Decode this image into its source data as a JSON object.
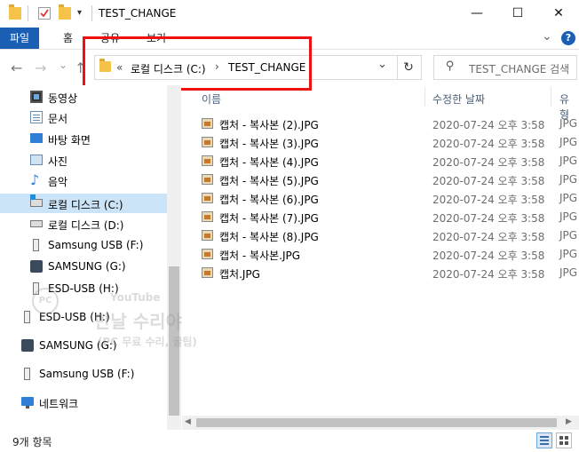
{
  "window": {
    "title": "TEST_CHANGE",
    "minimize": "—",
    "maximize": "☐",
    "close": "✕"
  },
  "ribbon": {
    "file_tab": "파일",
    "tabs": [
      "홈",
      "공유",
      "보기"
    ],
    "expand": "⌄",
    "help": "?"
  },
  "nav": {
    "back": "←",
    "forward": "→",
    "recent": "⌄",
    "up": "↑",
    "breadcrumb_overflow": "«",
    "crumbs": [
      "로컬 디스크 (C:)",
      "TEST_CHANGE"
    ],
    "separator": "›",
    "address_dropdown": "⌄",
    "refresh": "↻",
    "search_placeholder": "TEST_CHANGE 검색",
    "search_icon": "⚲"
  },
  "sidebar": {
    "items": [
      {
        "label": "동영상",
        "icon": "video-icon",
        "selected": false
      },
      {
        "label": "문서",
        "icon": "document-icon",
        "selected": false
      },
      {
        "label": "바탕 화면",
        "icon": "desktop-icon",
        "selected": false
      },
      {
        "label": "사진",
        "icon": "pictures-icon",
        "selected": false
      },
      {
        "label": "음악",
        "icon": "music-icon",
        "selected": false
      },
      {
        "label": "로컬 디스크 (C:)",
        "icon": "drive-c-icon",
        "selected": true
      },
      {
        "label": "로컬 디스크 (D:)",
        "icon": "drive-d-icon",
        "selected": false
      },
      {
        "label": "Samsung USB (F:)",
        "icon": "usb-drive-icon",
        "selected": false
      },
      {
        "label": "SAMSUNG (G:)",
        "icon": "removable-drive-icon",
        "selected": false
      },
      {
        "label": "ESD-USB (H:)",
        "icon": "usb-drive-icon",
        "selected": false
      }
    ],
    "items_root": [
      {
        "label": "ESD-USB (H:)",
        "icon": "usb-drive-icon"
      },
      {
        "label": "SAMSUNG (G:)",
        "icon": "removable-drive-icon"
      },
      {
        "label": "Samsung USB (F:)",
        "icon": "usb-drive-icon"
      },
      {
        "label": "네트워크",
        "icon": "network-icon"
      }
    ]
  },
  "filelist": {
    "columns": {
      "name": "이름",
      "date": "수정한 날짜",
      "type": "유형"
    },
    "rows": [
      {
        "name": "캡처 - 복사본 (2).JPG",
        "date": "2020-07-24 오후 3:58",
        "type": "JPG"
      },
      {
        "name": "캡처 - 복사본 (3).JPG",
        "date": "2020-07-24 오후 3:58",
        "type": "JPG"
      },
      {
        "name": "캡처 - 복사본 (4).JPG",
        "date": "2020-07-24 오후 3:58",
        "type": "JPG"
      },
      {
        "name": "캡처 - 복사본 (5).JPG",
        "date": "2020-07-24 오후 3:58",
        "type": "JPG"
      },
      {
        "name": "캡처 - 복사본 (6).JPG",
        "date": "2020-07-24 오후 3:58",
        "type": "JPG"
      },
      {
        "name": "캡처 - 복사본 (7).JPG",
        "date": "2020-07-24 오후 3:58",
        "type": "JPG"
      },
      {
        "name": "캡처 - 복사본 (8).JPG",
        "date": "2020-07-24 오후 3:58",
        "type": "JPG"
      },
      {
        "name": "캡처 - 복사본.JPG",
        "date": "2020-07-24 오후 3:58",
        "type": "JPG"
      },
      {
        "name": "캡처.JPG",
        "date": "2020-07-24 오후 3:58",
        "type": "JPG"
      }
    ]
  },
  "status": {
    "count": "9개 항목"
  },
  "watermark": {
    "badge": "PC",
    "channel": "YouTube",
    "name": "만날 수리야",
    "tagline": "(PC 무료 수리, 꿀팁)"
  },
  "colors": {
    "accent": "#1a5fb4",
    "selection": "#cce4f7",
    "highlight_border": "#e11111"
  }
}
